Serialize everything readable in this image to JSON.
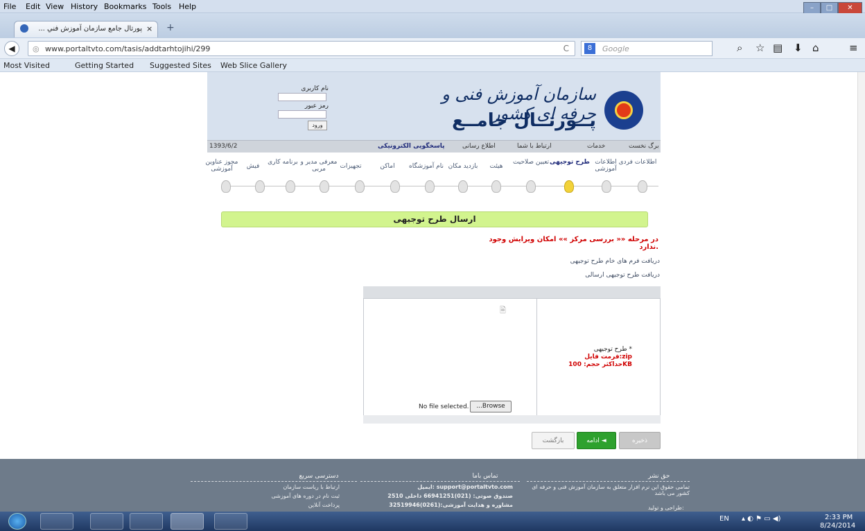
{
  "menu": [
    "File",
    "Edit",
    "View",
    "History",
    "Bookmarks",
    "Tools",
    "Help"
  ],
  "tab": {
    "title": "... پورتال جامع سازمان آموزش فني",
    "close": "×",
    "new": "+"
  },
  "nav": {
    "url": "www.portaltvto.com/tasis/addtarhtojihi/299",
    "search_engine": "8",
    "search_placeholder": "Google"
  },
  "bookmarks": [
    "Most Visited",
    "Getting Started",
    "Suggested Sites",
    "Web Slice Gallery"
  ],
  "header": {
    "title1": "سازمان آموزش فنی و حرفه ای کشور",
    "title2": "پــورتــال جامــع",
    "username_label": "نام کاربری",
    "password_label": "رمز عبور",
    "login_button": "ورود",
    "date": "1393/6/2"
  },
  "top_nav": [
    "برگ نخست",
    "خدمات",
    "ارتباط با شما",
    "اطلاع رسانی",
    "پاسخگویی الکترونیکی"
  ],
  "steps": [
    "اطلاعات فردی",
    "اطلاعات آموزشی",
    "طرح توجیهی",
    "تعیین صلاحیت",
    "هیئت",
    "بازدید مکان",
    "نام آموزشگاه",
    "اماکن",
    "تجهیزات",
    "معرفی مدیر و مربی",
    "برنامه کاری",
    "فیش",
    "مجوز عناوین آموزشی"
  ],
  "form": {
    "heading": "ارسال طرح توجیهی",
    "warning": "در مرحله «« بررسی مرکز »» امکان ویرایش وجود ندارد.",
    "link1": "دریافت فرم های خام طرح توجیهی",
    "link2": "دریافت طرح توجیهی ارسالی",
    "field_label": "طرح توجیهی *",
    "format": "فرمت فایل:zip",
    "maxsize": "حداکثر حجم: 100KB",
    "no_file": "No file selected.",
    "browse": "...Browse"
  },
  "buttons": {
    "save": "ذخیره",
    "next": "ادامه ◄",
    "back": "بازگشت"
  },
  "footer": {
    "col1_title": "حق نشر",
    "col1_text": "تمامی حقوق این نرم افزار متعلق به سازمان آموزش فنی و حرفه ای کشور می باشد",
    "col1_extra": "طراحی و تولید:",
    "col2_title": "تماس باما",
    "col2_email": "ایمیل: support@portaltvto.com",
    "col2_phone": "صندوق صوتی: (021)66941251 داخلی 2510",
    "col2_advice": "مشاوره و هدایت آموزشی:(0261)32519946",
    "col3_title": "دسترسی سریع",
    "col3_links": [
      "ارتباط با ریاست سازمان",
      "ثبت نام در دوره های آموزشی",
      "پرداخت آنلاین"
    ]
  },
  "tray": {
    "lang": "EN",
    "time": "2:33 PM",
    "date": "8/24/2014"
  }
}
